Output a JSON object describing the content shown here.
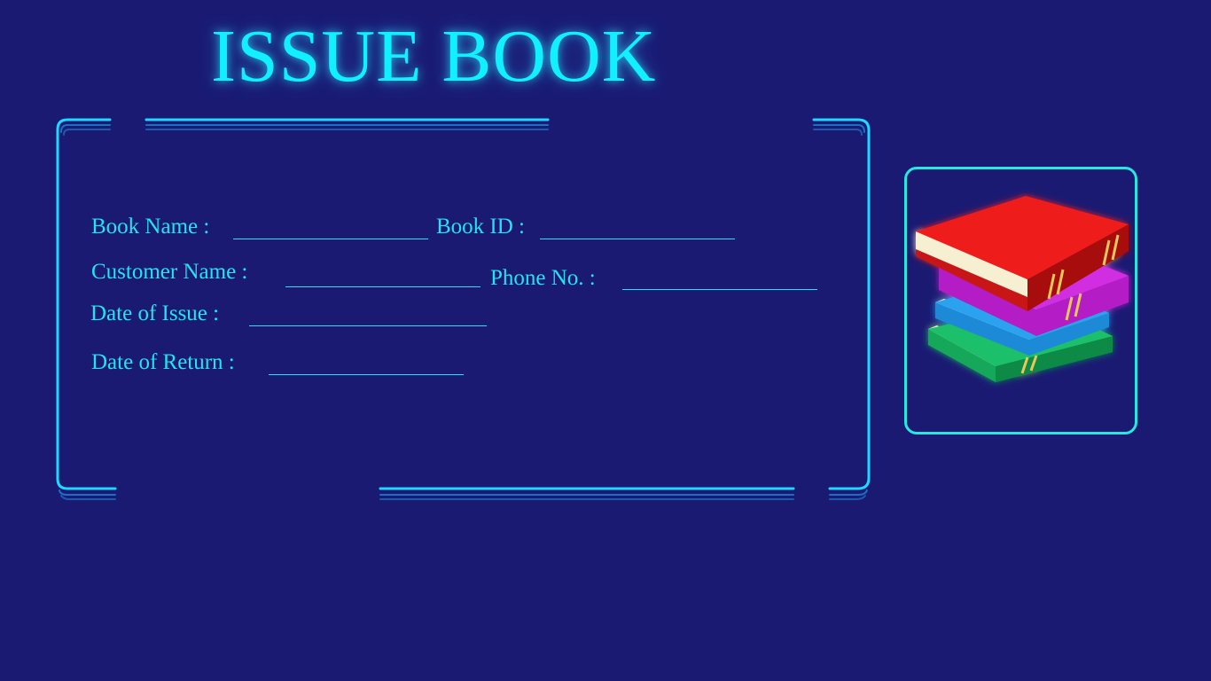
{
  "page": {
    "title": "ISSUE BOOK"
  },
  "form": {
    "book_name_label": "Book Name :",
    "book_name_value": "",
    "book_id_label": "Book ID :",
    "book_id_value": "",
    "customer_name_label": "Customer Name :",
    "customer_name_value": "",
    "phone_label": "Phone No. :",
    "phone_value": "",
    "date_issue_label": "Date of Issue :",
    "date_issue_value": "",
    "date_return_label": "Date of Return :",
    "date_return_value": ""
  },
  "image": {
    "icon": "stacked-books-icon"
  },
  "colors": {
    "background": "#1a1a73",
    "accent": "#22e3f0",
    "frame": "#1fd7ff"
  }
}
